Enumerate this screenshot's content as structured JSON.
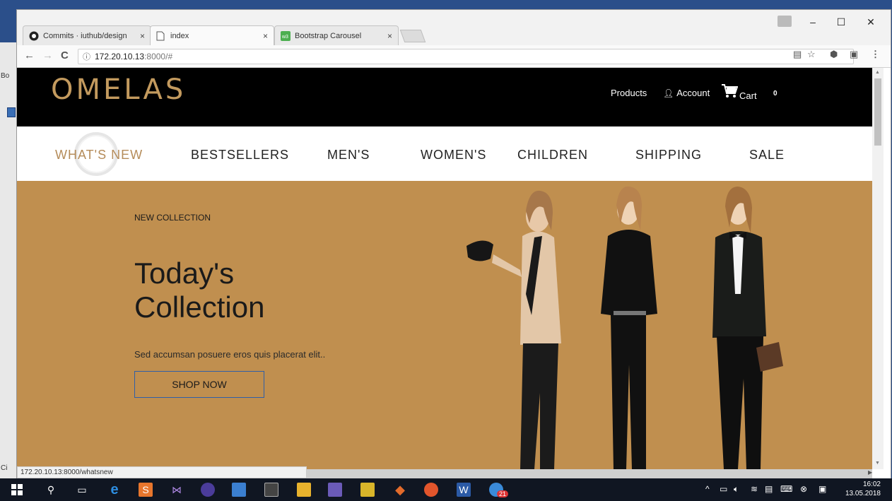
{
  "desktop": {
    "left_label_top": "Bo",
    "left_label_bottom": "Ci"
  },
  "browser": {
    "tabs": [
      {
        "title": "Commits · iuthub/design",
        "icon": "github-icon"
      },
      {
        "title": "index",
        "icon": "page-icon",
        "active": true
      },
      {
        "title": "Bootstrap Carousel",
        "icon": "w3schools-icon"
      }
    ],
    "tab_close_glyph": "×",
    "window_controls": {
      "minimize": "–",
      "maximize": "☐",
      "close": "✕"
    },
    "nav": {
      "back": "←",
      "forward": "→",
      "reload": "C"
    },
    "address": {
      "host": "172.20.10.13",
      "rest": ":8000/#"
    },
    "status_url": "172.20.10.13:8000/whatsnew"
  },
  "site": {
    "logo": "OMELAS",
    "header_links": {
      "products": "Products",
      "account": "Account",
      "cart": "Cart",
      "cart_count": "0"
    },
    "nav": [
      {
        "label": "WHAT'S NEW",
        "active": true
      },
      {
        "label": "BESTSELLERS"
      },
      {
        "label": "MEN'S"
      },
      {
        "label": "WOMEN'S"
      },
      {
        "label": "CHILDREN"
      },
      {
        "label": "SHIPPING"
      },
      {
        "label": "SALE"
      }
    ],
    "hero": {
      "eyebrow": "NEW COLLECTION",
      "title": "Today's Collection",
      "text": "Sed accumsan posuere eros quis placerat elit..",
      "button": "SHOP NOW"
    },
    "colors": {
      "header_bg": "#000000",
      "logo": "#c39a5e",
      "hero_bg": "#c08f4f",
      "nav_active": "#b58c5a",
      "button_border": "#2f5fa8"
    }
  },
  "taskbar": {
    "time": "16:02",
    "date": "13.05.2018",
    "badge": "21"
  }
}
